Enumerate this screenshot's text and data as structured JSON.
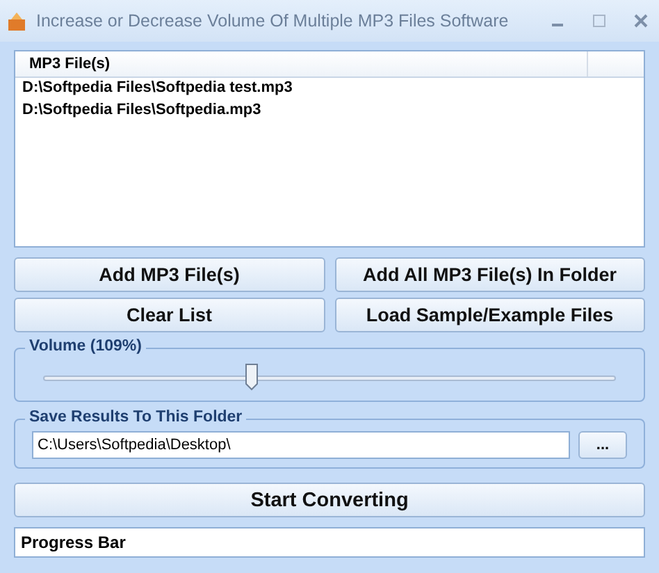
{
  "window": {
    "title": "Increase or Decrease Volume Of Multiple MP3 Files Software"
  },
  "file_list": {
    "column": "MP3 File(s)",
    "rows": [
      "D:\\Softpedia Files\\Softpedia test.mp3",
      "D:\\Softpedia Files\\Softpedia.mp3"
    ]
  },
  "buttons": [
    [
      "Add MP3 File(s)",
      "Add All MP3 File(s) In Folder"
    ],
    [
      "Clear List",
      "Load Sample/Example Files"
    ]
  ],
  "volume": {
    "label": "Volume (109%)",
    "level": 0.365
  },
  "output": {
    "label": "Save Results To This Folder",
    "value": "C:\\Users\\Softpedia\\Desktop\\",
    "browse": "..."
  },
  "start_button": "Start Converting",
  "progress": {
    "text": "Progress Bar"
  }
}
